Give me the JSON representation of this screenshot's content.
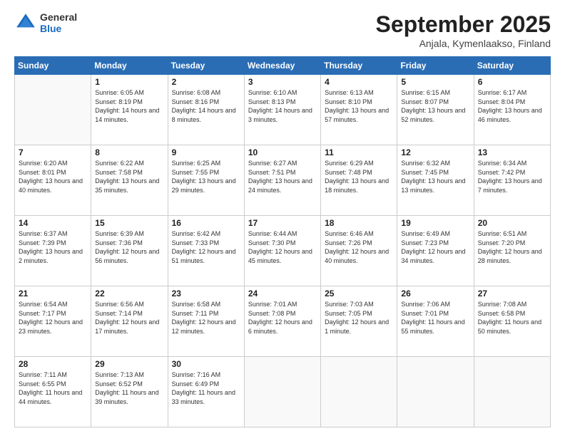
{
  "logo": {
    "general": "General",
    "blue": "Blue"
  },
  "header": {
    "title": "September 2025",
    "subtitle": "Anjala, Kymenlaakso, Finland"
  },
  "weekdays": [
    "Sunday",
    "Monday",
    "Tuesday",
    "Wednesday",
    "Thursday",
    "Friday",
    "Saturday"
  ],
  "weeks": [
    [
      {
        "day": "",
        "empty": true
      },
      {
        "day": "1",
        "sunrise": "6:05 AM",
        "sunset": "8:19 PM",
        "daylight": "14 hours and 14 minutes."
      },
      {
        "day": "2",
        "sunrise": "6:08 AM",
        "sunset": "8:16 PM",
        "daylight": "14 hours and 8 minutes."
      },
      {
        "day": "3",
        "sunrise": "6:10 AM",
        "sunset": "8:13 PM",
        "daylight": "14 hours and 3 minutes."
      },
      {
        "day": "4",
        "sunrise": "6:13 AM",
        "sunset": "8:10 PM",
        "daylight": "13 hours and 57 minutes."
      },
      {
        "day": "5",
        "sunrise": "6:15 AM",
        "sunset": "8:07 PM",
        "daylight": "13 hours and 52 minutes."
      },
      {
        "day": "6",
        "sunrise": "6:17 AM",
        "sunset": "8:04 PM",
        "daylight": "13 hours and 46 minutes."
      }
    ],
    [
      {
        "day": "7",
        "sunrise": "6:20 AM",
        "sunset": "8:01 PM",
        "daylight": "13 hours and 40 minutes."
      },
      {
        "day": "8",
        "sunrise": "6:22 AM",
        "sunset": "7:58 PM",
        "daylight": "13 hours and 35 minutes."
      },
      {
        "day": "9",
        "sunrise": "6:25 AM",
        "sunset": "7:55 PM",
        "daylight": "13 hours and 29 minutes."
      },
      {
        "day": "10",
        "sunrise": "6:27 AM",
        "sunset": "7:51 PM",
        "daylight": "13 hours and 24 minutes."
      },
      {
        "day": "11",
        "sunrise": "6:29 AM",
        "sunset": "7:48 PM",
        "daylight": "13 hours and 18 minutes."
      },
      {
        "day": "12",
        "sunrise": "6:32 AM",
        "sunset": "7:45 PM",
        "daylight": "13 hours and 13 minutes."
      },
      {
        "day": "13",
        "sunrise": "6:34 AM",
        "sunset": "7:42 PM",
        "daylight": "13 hours and 7 minutes."
      }
    ],
    [
      {
        "day": "14",
        "sunrise": "6:37 AM",
        "sunset": "7:39 PM",
        "daylight": "13 hours and 2 minutes."
      },
      {
        "day": "15",
        "sunrise": "6:39 AM",
        "sunset": "7:36 PM",
        "daylight": "12 hours and 56 minutes."
      },
      {
        "day": "16",
        "sunrise": "6:42 AM",
        "sunset": "7:33 PM",
        "daylight": "12 hours and 51 minutes."
      },
      {
        "day": "17",
        "sunrise": "6:44 AM",
        "sunset": "7:30 PM",
        "daylight": "12 hours and 45 minutes."
      },
      {
        "day": "18",
        "sunrise": "6:46 AM",
        "sunset": "7:26 PM",
        "daylight": "12 hours and 40 minutes."
      },
      {
        "day": "19",
        "sunrise": "6:49 AM",
        "sunset": "7:23 PM",
        "daylight": "12 hours and 34 minutes."
      },
      {
        "day": "20",
        "sunrise": "6:51 AM",
        "sunset": "7:20 PM",
        "daylight": "12 hours and 28 minutes."
      }
    ],
    [
      {
        "day": "21",
        "sunrise": "6:54 AM",
        "sunset": "7:17 PM",
        "daylight": "12 hours and 23 minutes."
      },
      {
        "day": "22",
        "sunrise": "6:56 AM",
        "sunset": "7:14 PM",
        "daylight": "12 hours and 17 minutes."
      },
      {
        "day": "23",
        "sunrise": "6:58 AM",
        "sunset": "7:11 PM",
        "daylight": "12 hours and 12 minutes."
      },
      {
        "day": "24",
        "sunrise": "7:01 AM",
        "sunset": "7:08 PM",
        "daylight": "12 hours and 6 minutes."
      },
      {
        "day": "25",
        "sunrise": "7:03 AM",
        "sunset": "7:05 PM",
        "daylight": "12 hours and 1 minute."
      },
      {
        "day": "26",
        "sunrise": "7:06 AM",
        "sunset": "7:01 PM",
        "daylight": "11 hours and 55 minutes."
      },
      {
        "day": "27",
        "sunrise": "7:08 AM",
        "sunset": "6:58 PM",
        "daylight": "11 hours and 50 minutes."
      }
    ],
    [
      {
        "day": "28",
        "sunrise": "7:11 AM",
        "sunset": "6:55 PM",
        "daylight": "11 hours and 44 minutes."
      },
      {
        "day": "29",
        "sunrise": "7:13 AM",
        "sunset": "6:52 PM",
        "daylight": "11 hours and 39 minutes."
      },
      {
        "day": "30",
        "sunrise": "7:16 AM",
        "sunset": "6:49 PM",
        "daylight": "11 hours and 33 minutes."
      },
      {
        "day": "",
        "empty": true
      },
      {
        "day": "",
        "empty": true
      },
      {
        "day": "",
        "empty": true
      },
      {
        "day": "",
        "empty": true
      }
    ]
  ]
}
